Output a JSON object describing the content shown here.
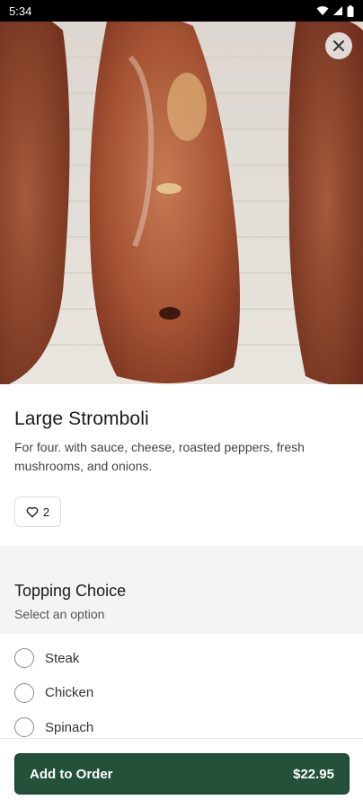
{
  "status_bar": {
    "time": "5:34"
  },
  "item": {
    "title": "Large Stromboli",
    "description": "For four. with sauce, cheese, roasted peppers, fresh mushrooms, and onions.",
    "likes": "2"
  },
  "section": {
    "title": "Topping Choice",
    "subtitle": "Select an option",
    "options": [
      "Steak",
      "Chicken",
      "Spinach"
    ]
  },
  "order": {
    "label": "Add to Order",
    "price": "$22.95"
  },
  "colors": {
    "accent": "#235139"
  },
  "icons": {
    "close": "close-icon",
    "like": "heart-icon",
    "wifi": "wifi-icon",
    "signal": "signal-icon",
    "battery": "battery-icon"
  }
}
